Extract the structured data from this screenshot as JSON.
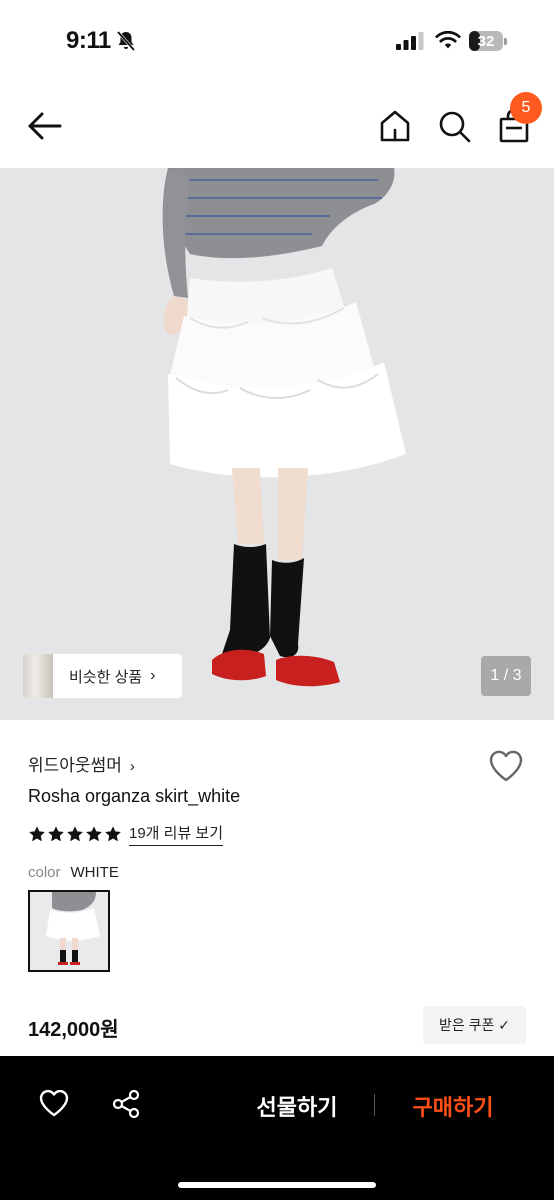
{
  "status_bar": {
    "time": "9:11",
    "battery": "32",
    "battery_level": 0.32
  },
  "nav": {
    "cart_count": "5"
  },
  "hero": {
    "similar_label": "비슷한 상품",
    "page_indicator": "1 / 3"
  },
  "product": {
    "brand": "위드아웃썸머",
    "name": "Rosha organza skirt_white",
    "rating": 5,
    "reviews_link": "19개 리뷰 보기",
    "color_label": "color",
    "color_value": "WHITE",
    "price": "142,000원",
    "coupon_label": "받은 쿠폰 ✓"
  },
  "bottom_bar": {
    "gift_label": "선물하기",
    "buy_label": "구매하기"
  },
  "colors": {
    "accent": "#ff4f17",
    "badge": "#ff5a1f",
    "bottom_bar_bg": "#000000"
  }
}
